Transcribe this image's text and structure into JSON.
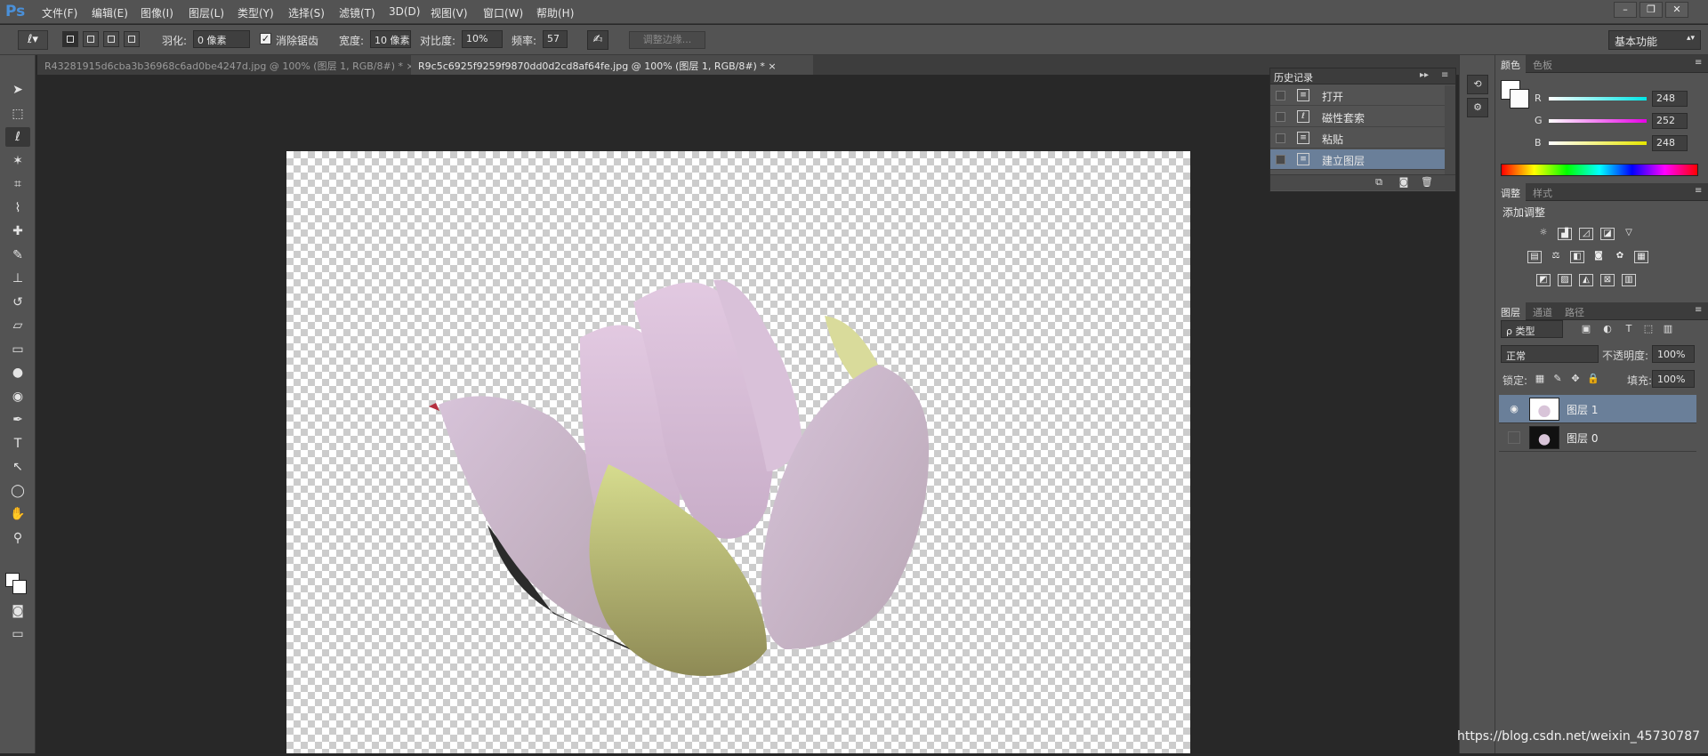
{
  "app": {
    "logo": "Ps"
  },
  "menu": [
    "文件(F)",
    "编辑(E)",
    "图像(I)",
    "图层(L)",
    "类型(Y)",
    "选择(S)",
    "滤镜(T)",
    "3D(D)",
    "视图(V)",
    "窗口(W)",
    "帮助(H)"
  ],
  "window_controls": [
    "–",
    "❐",
    "✕"
  ],
  "options": {
    "feather_label": "羽化:",
    "feather_value": "0 像素",
    "antialias_label": "消除锯齿",
    "antialias_checked": true,
    "width_label": "宽度:",
    "width_value": "10 像素",
    "contrast_label": "对比度:",
    "contrast_value": "10%",
    "frequency_label": "频率:",
    "frequency_value": "57",
    "refine_edge": "调整边缘...",
    "workspace": "基本功能"
  },
  "tabs": [
    {
      "label": "R43281915d6cba3b36968c6ad0be4247d.jpg @ 100% (图层 1, RGB/8#) *",
      "close": "×"
    },
    {
      "label": "R9c5c6925f9259f9870dd0d2cd8af64fe.jpg @ 100% (图层 1, RGB/8#) *",
      "close": "×"
    }
  ],
  "tools": [
    {
      "name": "move-tool-icon",
      "glyph": "➤"
    },
    {
      "name": "marquee-tool-icon",
      "glyph": "⬚"
    },
    {
      "name": "magnetic-lasso-tool-icon",
      "glyph": "ℓ"
    },
    {
      "name": "magic-wand-tool-icon",
      "glyph": "✶"
    },
    {
      "name": "crop-tool-icon",
      "glyph": "⌗"
    },
    {
      "name": "eyedropper-tool-icon",
      "glyph": "⌇"
    },
    {
      "name": "healing-brush-tool-icon",
      "glyph": "✚"
    },
    {
      "name": "brush-tool-icon",
      "glyph": "✎"
    },
    {
      "name": "stamp-tool-icon",
      "glyph": "⊥"
    },
    {
      "name": "history-brush-tool-icon",
      "glyph": "↺"
    },
    {
      "name": "eraser-tool-icon",
      "glyph": "▱"
    },
    {
      "name": "gradient-tool-icon",
      "glyph": "▭"
    },
    {
      "name": "blur-tool-icon",
      "glyph": "●"
    },
    {
      "name": "dodge-tool-icon",
      "glyph": "◉"
    },
    {
      "name": "pen-tool-icon",
      "glyph": "✒"
    },
    {
      "name": "type-tool-icon",
      "glyph": "T"
    },
    {
      "name": "path-select-tool-icon",
      "glyph": "↖"
    },
    {
      "name": "ellipse-tool-icon",
      "glyph": "◯"
    },
    {
      "name": "hand-tool-icon",
      "glyph": "✋"
    },
    {
      "name": "zoom-tool-icon",
      "glyph": "⚲"
    }
  ],
  "history": {
    "title": "历史记录",
    "items": [
      "打开",
      "磁性套索",
      "粘贴",
      "建立图层"
    ],
    "selected": 3
  },
  "color": {
    "tabs": [
      "颜色",
      "色板"
    ],
    "channels": [
      {
        "label": "R",
        "value": "248",
        "gradient": "#00e6e6"
      },
      {
        "label": "G",
        "value": "252",
        "gradient": "#e600e6"
      },
      {
        "label": "B",
        "value": "248",
        "gradient": "#e6e600"
      }
    ]
  },
  "adjustments": {
    "tabs": [
      "调整",
      "样式"
    ],
    "add_label": "添加调整"
  },
  "layers": {
    "tabs": [
      "图层",
      "通道",
      "路径"
    ],
    "filter": "ρ 类型",
    "blend_mode": "正常",
    "opacity_label": "不透明度:",
    "opacity_value": "100%",
    "lock_label": "锁定:",
    "fill_label": "填充:",
    "fill_value": "100%",
    "items": [
      {
        "name": "图层 1",
        "visible": true,
        "selected": true
      },
      {
        "name": "图层 0",
        "visible": false,
        "selected": false
      }
    ]
  },
  "watermark": "https://blog.csdn.net/weixin_45730787"
}
